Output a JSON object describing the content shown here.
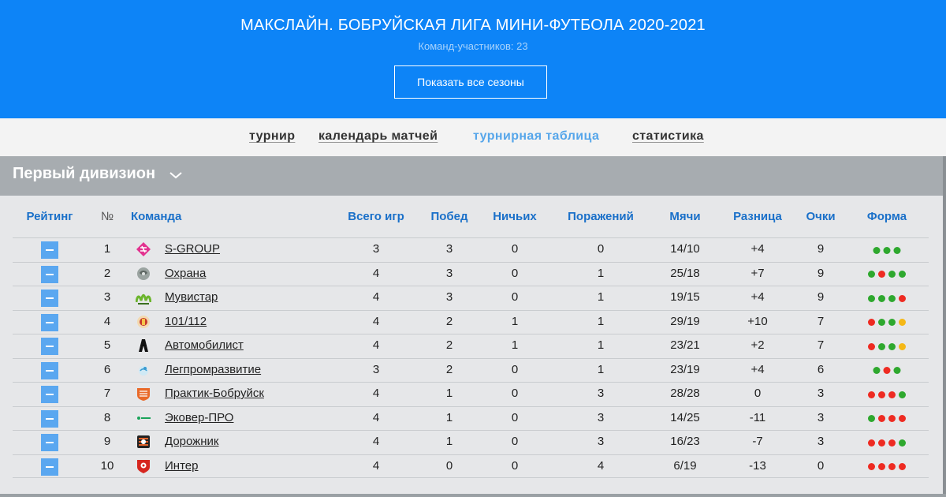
{
  "header": {
    "title": "МАКСЛАЙН. БОБРУЙСКАЯ ЛИГА МИНИ-ФУТБОЛА 2020-2021",
    "subtitle": "Команд-участников: 23",
    "seasons_button": "Показать все сезоны"
  },
  "nav": {
    "tabs": [
      {
        "label": "турнир",
        "active": false
      },
      {
        "label": "календарь матчей",
        "active": false
      },
      {
        "label": "турнирная таблица",
        "active": true
      },
      {
        "label": "статистика",
        "active": false
      }
    ]
  },
  "division": {
    "title": "Первый дивизион"
  },
  "colors": {
    "win": "#2ea82e",
    "loss": "#ee2b22",
    "draw": "#f5b817",
    "header_bg": "#0d84f7",
    "link": "#1a70c9"
  },
  "table": {
    "columns": {
      "rating": "Рейтинг",
      "num": "№",
      "team": "Команда",
      "games": "Всего игр",
      "wins": "Побед",
      "draws": "Ничьих",
      "losses": "Поражений",
      "goals": "Мячи",
      "diff": "Разница",
      "points": "Очки",
      "form": "Форма"
    },
    "rows": [
      {
        "num": "1",
        "team": "S-GROUP",
        "logo": "sgroup-logo",
        "games": "3",
        "wins": "3",
        "draws": "0",
        "losses": "0",
        "goals": "14/10",
        "diff": "+4",
        "points": "9",
        "form": [
          "W",
          "W",
          "W"
        ]
      },
      {
        "num": "2",
        "team": "Охрана",
        "logo": "okhrana-logo",
        "games": "4",
        "wins": "3",
        "draws": "0",
        "losses": "1",
        "goals": "25/18",
        "diff": "+7",
        "points": "9",
        "form": [
          "W",
          "L",
          "W",
          "W"
        ]
      },
      {
        "num": "3",
        "team": "Мувистар",
        "logo": "movistar-logo",
        "games": "4",
        "wins": "3",
        "draws": "0",
        "losses": "1",
        "goals": "19/15",
        "diff": "+4",
        "points": "9",
        "form": [
          "W",
          "W",
          "W",
          "L"
        ]
      },
      {
        "num": "4",
        "team": "101/112",
        "logo": "101-112-logo",
        "games": "4",
        "wins": "2",
        "draws": "1",
        "losses": "1",
        "goals": "29/19",
        "diff": "+10",
        "points": "7",
        "form": [
          "L",
          "W",
          "W",
          "D"
        ]
      },
      {
        "num": "5",
        "team": "Автомобилист",
        "logo": "avtomobilist-logo",
        "games": "4",
        "wins": "2",
        "draws": "1",
        "losses": "1",
        "goals": "23/21",
        "diff": "+2",
        "points": "7",
        "form": [
          "L",
          "W",
          "W",
          "D"
        ]
      },
      {
        "num": "6",
        "team": "Легпромразвитие",
        "logo": "legprom-logo",
        "games": "3",
        "wins": "2",
        "draws": "0",
        "losses": "1",
        "goals": "23/19",
        "diff": "+4",
        "points": "6",
        "form": [
          "W",
          "L",
          "W"
        ]
      },
      {
        "num": "7",
        "team": "Практик-Бобруйск",
        "logo": "praktik-logo",
        "games": "4",
        "wins": "1",
        "draws": "0",
        "losses": "3",
        "goals": "28/28",
        "diff": "0",
        "points": "3",
        "form": [
          "L",
          "L",
          "L",
          "W"
        ]
      },
      {
        "num": "8",
        "team": "Эковер-ПРО",
        "logo": "ekover-logo",
        "games": "4",
        "wins": "1",
        "draws": "0",
        "losses": "3",
        "goals": "14/25",
        "diff": "-11",
        "points": "3",
        "form": [
          "W",
          "L",
          "L",
          "L"
        ]
      },
      {
        "num": "9",
        "team": "Дорожник",
        "logo": "dorozhnik-logo",
        "games": "4",
        "wins": "1",
        "draws": "0",
        "losses": "3",
        "goals": "16/23",
        "diff": "-7",
        "points": "3",
        "form": [
          "L",
          "L",
          "L",
          "W"
        ]
      },
      {
        "num": "10",
        "team": "Интер",
        "logo": "inter-logo",
        "games": "4",
        "wins": "0",
        "draws": "0",
        "losses": "4",
        "goals": "6/19",
        "diff": "-13",
        "points": "0",
        "form": [
          "L",
          "L",
          "L",
          "L"
        ]
      }
    ]
  }
}
